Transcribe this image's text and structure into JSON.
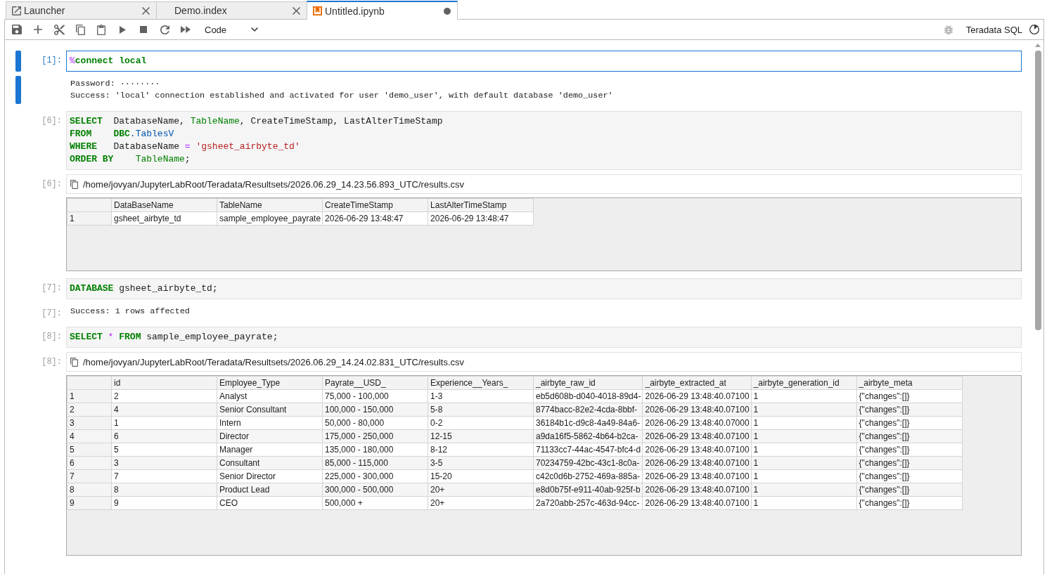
{
  "tabs": [
    {
      "label": "Launcher",
      "kind": "launcher",
      "selected": false,
      "modified": false
    },
    {
      "label": "Demo.index",
      "kind": "file",
      "selected": false,
      "modified": false
    },
    {
      "label": "Untitled.ipynb",
      "kind": "notebook",
      "selected": true,
      "modified": true
    }
  ],
  "toolbar": {
    "cell_type": "Code",
    "debugger_enabled": false,
    "kernel_name": "Teradata SQL"
  },
  "cells": [
    {
      "prompt": "[1]:",
      "selected": true,
      "lines": [
        [
          {
            "text": "%",
            "kind": "magic"
          },
          {
            "text": "connect local",
            "kind": "keyword"
          }
        ]
      ],
      "outputs": [
        {
          "kind": "stream",
          "lines": [
            "Password: ········",
            "Success: 'local' connection established and activated for user 'demo_user', with default database 'demo_user'"
          ]
        }
      ]
    },
    {
      "prompt": "[6]:",
      "selected": false,
      "lines": [
        [
          {
            "text": "SELECT",
            "kind": "keyword"
          },
          {
            "text": "  DatabaseName, ",
            "kind": "plain"
          },
          {
            "text": "TableName",
            "kind": "builtin"
          },
          {
            "text": ", CreateTimeStamp, LastAlterTimeStamp",
            "kind": "plain"
          }
        ],
        [
          {
            "text": "FROM",
            "kind": "keyword"
          },
          {
            "text": "    DBC",
            "kind": "keyword"
          },
          {
            "text": ".TablesV",
            "kind": "name"
          }
        ],
        [
          {
            "text": "WHERE",
            "kind": "keyword"
          },
          {
            "text": "   DatabaseName ",
            "kind": "plain"
          },
          {
            "text": "=",
            "kind": "operator"
          },
          {
            "text": " 'gsheet_airbyte_td'",
            "kind": "string"
          }
        ],
        [
          {
            "text": "ORDER BY",
            "kind": "keyword"
          },
          {
            "text": "    TableName",
            "kind": "builtin"
          },
          {
            "text": ";",
            "kind": "plain"
          }
        ]
      ],
      "outputs": [
        {
          "kind": "resultset",
          "prompt": "[6]:",
          "path": "/home/jovyan/JupyterLabRoot/Teradata/Resultsets/2026.06.29_14.23.56.893_UTC/results.csv",
          "table": {
            "columns": [
              "DataBaseName",
              "TableName",
              "CreateTimeStamp",
              "LastAlterTimeStamp"
            ],
            "rows": [
              {
                "index": "1",
                "cells": [
                  "gsheet_airbyte_td",
                  "sample_employee_payrate",
                  "2026-06-29 13:48:47",
                  "2026-06-29 13:48:47"
                ]
              }
            ]
          }
        }
      ]
    },
    {
      "prompt": "[7]:",
      "selected": false,
      "lines": [
        [
          {
            "text": "DATABASE",
            "kind": "keyword"
          },
          {
            "text": " gsheet_airbyte_td;",
            "kind": "plain"
          }
        ]
      ],
      "outputs": [
        {
          "kind": "stream",
          "prompt": "[7]:",
          "lines": [
            "Success: 1 rows affected"
          ]
        }
      ]
    },
    {
      "prompt": "[8]:",
      "selected": false,
      "lines": [
        [
          {
            "text": "SELECT",
            "kind": "keyword"
          },
          {
            "text": " *",
            "kind": "operator"
          },
          {
            "text": " FROM",
            "kind": "keyword"
          },
          {
            "text": " sample_employee_payrate;",
            "kind": "plain"
          }
        ]
      ],
      "outputs": [
        {
          "kind": "resultset",
          "prompt": "[8]:",
          "path": "/home/jovyan/JupyterLabRoot/Teradata/Resultsets/2026.06.29_14.24.02.831_UTC/results.csv",
          "table": {
            "columns": [
              "id",
              "Employee_Type",
              "Payrate__USD_",
              "Experience__Years_",
              "_airbyte_raw_id",
              "_airbyte_extracted_at",
              "_airbyte_generation_id",
              "_airbyte_meta"
            ],
            "rows": [
              {
                "index": "1",
                "cells": [
                  "2",
                  "Analyst",
                  "75,000 - 100,000",
                  "1-3",
                  "eb5d608b-d040-4018-89d4-",
                  "2026-06-29 13:48:40.07100",
                  "1",
                  "{\"changes\":[]}"
                ]
              },
              {
                "index": "2",
                "cells": [
                  "4",
                  "Senior Consultant",
                  "100,000 - 150,000",
                  "5-8",
                  "8774bacc-82e2-4cda-8bbf-",
                  "2026-06-29 13:48:40.07100",
                  "1",
                  "{\"changes\":[]}"
                ]
              },
              {
                "index": "3",
                "cells": [
                  "1",
                  "Intern",
                  "50,000 - 80,000",
                  "0-2",
                  "36184b1c-d9c8-4a49-84a6-",
                  "2026-06-29 13:48:40.07000",
                  "1",
                  "{\"changes\":[]}"
                ]
              },
              {
                "index": "4",
                "cells": [
                  "6",
                  "Director",
                  "175,000 - 250,000",
                  "12-15",
                  "a9da16f5-5862-4b64-b2ca-",
                  "2026-06-29 13:48:40.07100",
                  "1",
                  "{\"changes\":[]}"
                ]
              },
              {
                "index": "5",
                "cells": [
                  "5",
                  "Manager",
                  "135,000 - 180,000",
                  "8-12",
                  "71133cc7-44ac-4547-bfc4-d",
                  "2026-06-29 13:48:40.07100",
                  "1",
                  "{\"changes\":[]}"
                ]
              },
              {
                "index": "6",
                "cells": [
                  "3",
                  "Consultant",
                  "85,000 - 115,000",
                  "3-5",
                  "70234759-42bc-43c1-8c0a-",
                  "2026-06-29 13:48:40.07100",
                  "1",
                  "{\"changes\":[]}"
                ]
              },
              {
                "index": "7",
                "cells": [
                  "7",
                  "Senior Director",
                  "225,000 - 300,000",
                  "15-20",
                  "c42c0d6b-2752-469a-885a-",
                  "2026-06-29 13:48:40.07100",
                  "1",
                  "{\"changes\":[]}"
                ]
              },
              {
                "index": "8",
                "cells": [
                  "8",
                  "Product Lead",
                  "300,000 - 500,000",
                  "20+",
                  "e8d0b75f-e911-40ab-925f-b",
                  "2026-06-29 13:48:40.07100",
                  "1",
                  "{\"changes\":[]}"
                ]
              },
              {
                "index": "9",
                "cells": [
                  "9",
                  "CEO",
                  "500,000 +",
                  "20+",
                  "2a720abb-257c-463d-94cc-",
                  "2026-06-29 13:48:40.07100",
                  "1",
                  "{\"changes\":[]}"
                ]
              }
            ]
          }
        }
      ]
    }
  ]
}
